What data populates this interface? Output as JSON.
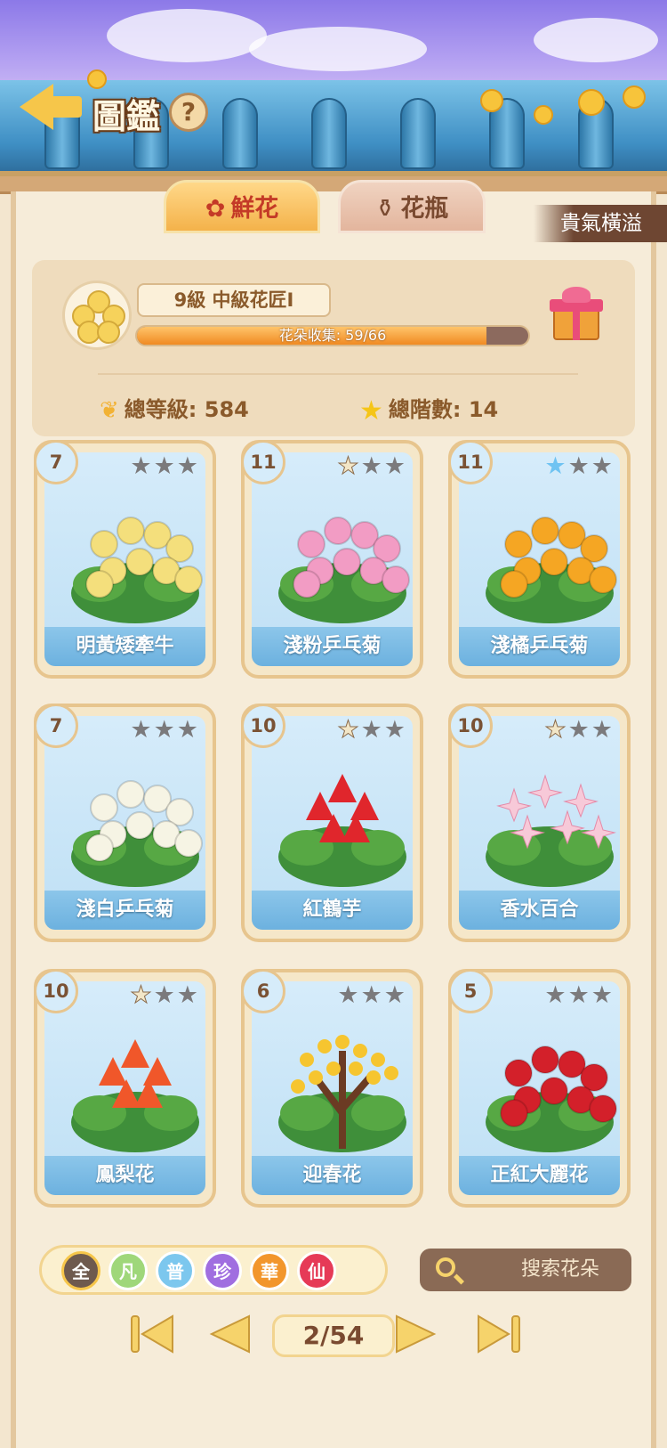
{
  "header": {
    "title": "圖鑑",
    "help_icon": "question-icon",
    "back_icon": "back-arrow-icon"
  },
  "tabs": [
    {
      "label": "鮮花",
      "icon": "rose-icon",
      "active": true
    },
    {
      "label": "花瓶",
      "icon": "vase-icon",
      "active": false
    }
  ],
  "banner": {
    "text": "貴氣橫溢"
  },
  "profile": {
    "level_title": "9級  中級花匠Ⅰ",
    "progress_label": "花朵收集: 59/66",
    "progress_fraction": 0.894,
    "total_level_label": "總等級: 584",
    "total_tier_label": "總階數: 14"
  },
  "cards": [
    {
      "name": "明黃矮牽牛",
      "level": "7",
      "stars": 0,
      "flower_color": "#f4df7c",
      "style": "petunia"
    },
    {
      "name": "淺粉乒乓菊",
      "level": "11",
      "stars": 1,
      "flower_color": "#f29cc4",
      "style": "pompom"
    },
    {
      "name": "淺橘乒乓菊",
      "level": "11",
      "stars": 1,
      "star_color": "blue",
      "flower_color": "#f5a623",
      "style": "pompom"
    },
    {
      "name": "淺白乒乓菊",
      "level": "7",
      "stars": 0,
      "flower_color": "#f6f4e4",
      "style": "pompom"
    },
    {
      "name": "紅鶴芋",
      "level": "10",
      "stars": 1,
      "flower_color": "#e0262c",
      "style": "anthurium"
    },
    {
      "name": "香水百合",
      "level": "10",
      "stars": 1,
      "flower_color": "#f7c9d8",
      "style": "lily"
    },
    {
      "name": "鳳梨花",
      "level": "10",
      "stars": 1,
      "flower_color": "#f0572a",
      "style": "bromeliad"
    },
    {
      "name": "迎春花",
      "level": "6",
      "stars": 0,
      "flower_color": "#f6c52f",
      "style": "tree"
    },
    {
      "name": "正紅大麗花",
      "level": "5",
      "stars": 0,
      "flower_color": "#d3202a",
      "style": "dahlia"
    }
  ],
  "filters": [
    {
      "label": "全",
      "color": "#6e5a4e",
      "selected": true
    },
    {
      "label": "凡",
      "color": "#9fd77a"
    },
    {
      "label": "普",
      "color": "#7cc7ee"
    },
    {
      "label": "珍",
      "color": "#a06ee0"
    },
    {
      "label": "華",
      "color": "#f2962c"
    },
    {
      "label": "仙",
      "color": "#e63a57"
    }
  ],
  "search": {
    "placeholder": "搜索花朵",
    "icon": "search-icon"
  },
  "pagination": {
    "label": "2/54",
    "first_icon": "first-page-icon",
    "prev_icon": "prev-page-icon",
    "next_icon": "next-page-icon",
    "last_icon": "last-page-icon"
  }
}
